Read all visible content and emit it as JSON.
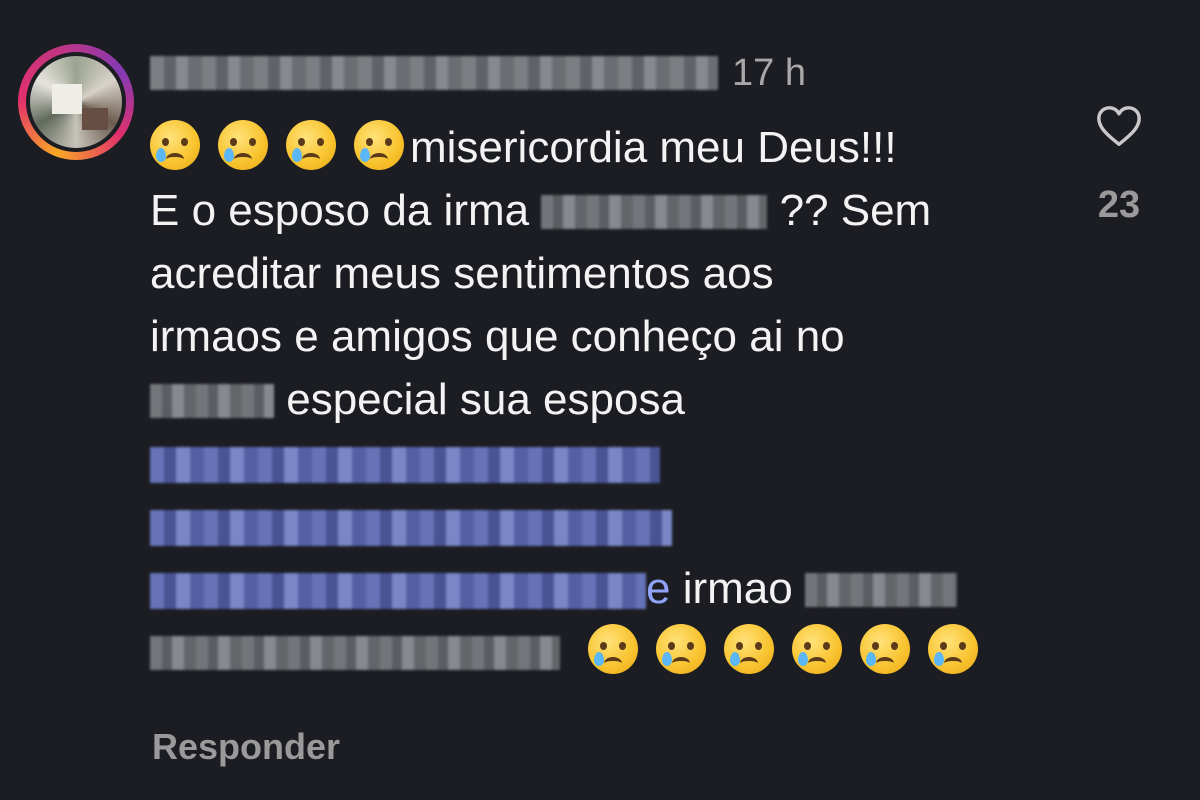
{
  "comment": {
    "time": "17 h",
    "lines": {
      "l1": "misericordia meu Deus!!!",
      "l2a": "E o esposo da irma",
      "l2b": "?? Sem",
      "l3": "acreditar meus sentimentos aos",
      "l4": "irmaos e amigos que conheço ai no",
      "l5": "especial sua esposa",
      "mention3_tail": "e",
      "l8": "irmao"
    },
    "emoji": "crying-face"
  },
  "actions": {
    "reply_label": "Responder",
    "like_count": "23"
  },
  "colors": {
    "background": "#1b1d22",
    "text": "#f3f3f3",
    "muted": "#9a9a9a",
    "mention": "#8fa2f5"
  }
}
